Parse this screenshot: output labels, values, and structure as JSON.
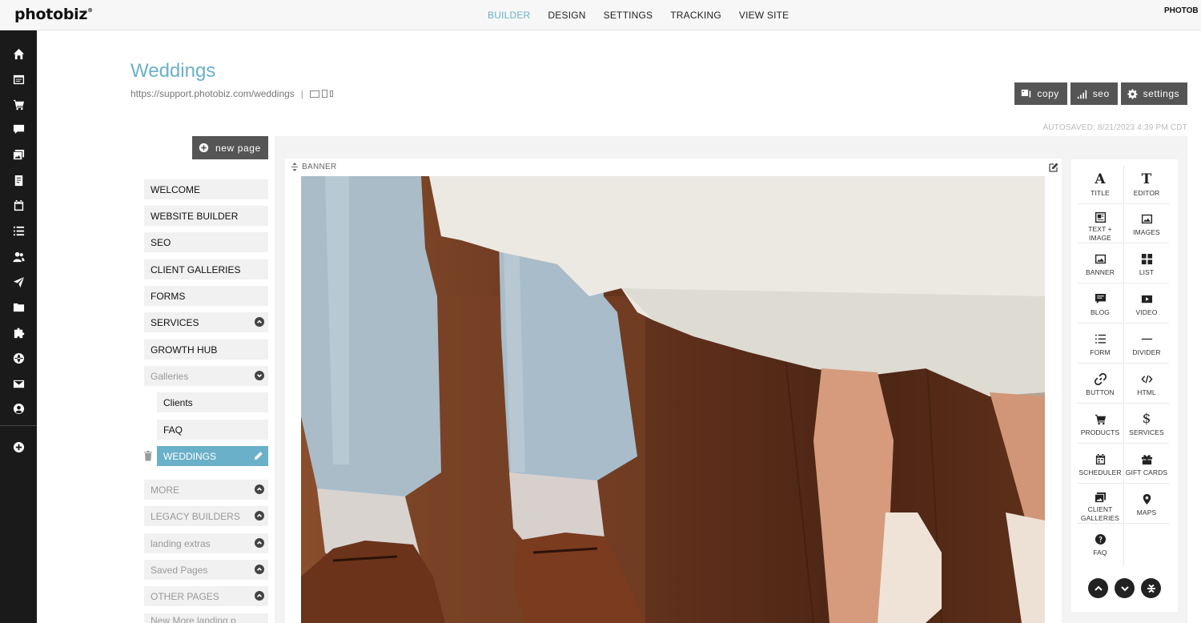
{
  "topbar": {
    "logo": "photobiz",
    "logo_mark": "®",
    "nav": [
      "BUILDER",
      "DESIGN",
      "SETTINGS",
      "TRACKING",
      "VIEW SITE"
    ],
    "active": "BUILDER",
    "account_label": "PHOTOB"
  },
  "rail": {
    "icons": [
      "home-icon",
      "browser-window-icon",
      "cart-icon",
      "chat-icon",
      "gallery-icon",
      "document-icon",
      "calendar-icon",
      "list-icon",
      "users-icon",
      "send-icon",
      "folder-icon",
      "puzzle-icon",
      "globe-icon",
      "mail-icon",
      "account-icon",
      "add-circle-icon"
    ]
  },
  "page": {
    "title": "Weddings",
    "url": "https://support.photobiz.com/weddings",
    "separator": "|",
    "autosaved": "AUTOSAVED: 8/21/2023 4:39 PM CDT",
    "actions": {
      "copy": "copy",
      "seo": "seo",
      "settings": "settings"
    }
  },
  "pagelist": {
    "new_page": "new page",
    "items": [
      {
        "label": "WELCOME"
      },
      {
        "label": "WEBSITE BUILDER"
      },
      {
        "label": "SEO"
      },
      {
        "label": "CLIENT GALLERIES"
      },
      {
        "label": "FORMS"
      },
      {
        "label": "SERVICES"
      },
      {
        "label": "GROWTH HUB"
      },
      {
        "label": "Galleries"
      },
      {
        "label": "Clients"
      },
      {
        "label": "FAQ"
      },
      {
        "label": "WEDDINGS"
      },
      {
        "label": "MORE"
      },
      {
        "label": "LEGACY BUILDERS"
      },
      {
        "label": "landing extras"
      },
      {
        "label": "Saved Pages"
      },
      {
        "label": "OTHER PAGES"
      },
      {
        "label": "New More landing p"
      }
    ]
  },
  "canvas": {
    "block_label": "BANNER"
  },
  "widgets": {
    "items": [
      {
        "label": "TITLE",
        "icon": "title-icon"
      },
      {
        "label": "EDITOR",
        "icon": "editor-icon"
      },
      {
        "label": "TEXT +\nIMAGE",
        "icon": "text-image-icon"
      },
      {
        "label": "IMAGES",
        "icon": "images-icon"
      },
      {
        "label": "BANNER",
        "icon": "banner-icon"
      },
      {
        "label": "LIST",
        "icon": "grid-icon"
      },
      {
        "label": "BLOG",
        "icon": "blog-icon"
      },
      {
        "label": "VIDEO",
        "icon": "video-icon"
      },
      {
        "label": "FORM",
        "icon": "form-icon"
      },
      {
        "label": "DIVIDER",
        "icon": "divider-icon"
      },
      {
        "label": "BUTTON",
        "icon": "link-icon"
      },
      {
        "label": "HTML",
        "icon": "code-icon"
      },
      {
        "label": "PRODUCTS",
        "icon": "cart-icon"
      },
      {
        "label": "SERVICES",
        "icon": "dollar-icon"
      },
      {
        "label": "SCHEDULER",
        "icon": "calendar-icon"
      },
      {
        "label": "GIFT CARDS",
        "icon": "gift-icon"
      },
      {
        "label": "CLIENT\nGALLERIES",
        "icon": "client-galleries-icon"
      },
      {
        "label": "MAPS",
        "icon": "map-pin-icon"
      },
      {
        "label": "FAQ",
        "icon": "question-icon"
      }
    ]
  }
}
